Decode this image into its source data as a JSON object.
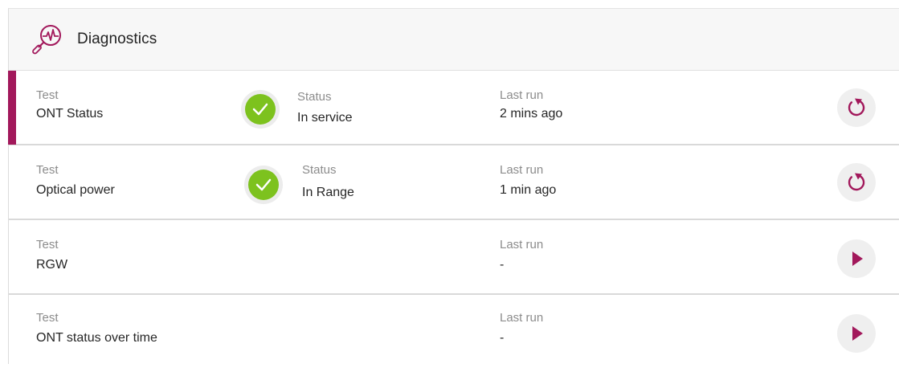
{
  "header": {
    "title": "Diagnostics",
    "icon": "diagnostics-magnifier-icon"
  },
  "colors": {
    "accent": "#a2185b",
    "success": "#7dc21e"
  },
  "tests": [
    {
      "test_label": "Test",
      "test_name": "ONT Status",
      "status_label": "Status",
      "status_value": "In service",
      "status_icon": "check-icon",
      "last_run_label": "Last run",
      "last_run_value": "2 mins ago",
      "action": "rerun-icon",
      "selected": true
    },
    {
      "test_label": "Test",
      "test_name": "Optical power",
      "status_label": "Status",
      "status_value": "In Range",
      "status_icon": "check-icon",
      "last_run_label": "Last run",
      "last_run_value": "1 min ago",
      "action": "rerun-icon",
      "selected": false
    },
    {
      "test_label": "Test",
      "test_name": "RGW",
      "last_run_label": "Last run",
      "last_run_value": "-",
      "action": "play-icon",
      "selected": false
    },
    {
      "test_label": "Test",
      "test_name": "ONT status over time",
      "last_run_label": "Last run",
      "last_run_value": "-",
      "action": "play-icon",
      "selected": false
    }
  ]
}
